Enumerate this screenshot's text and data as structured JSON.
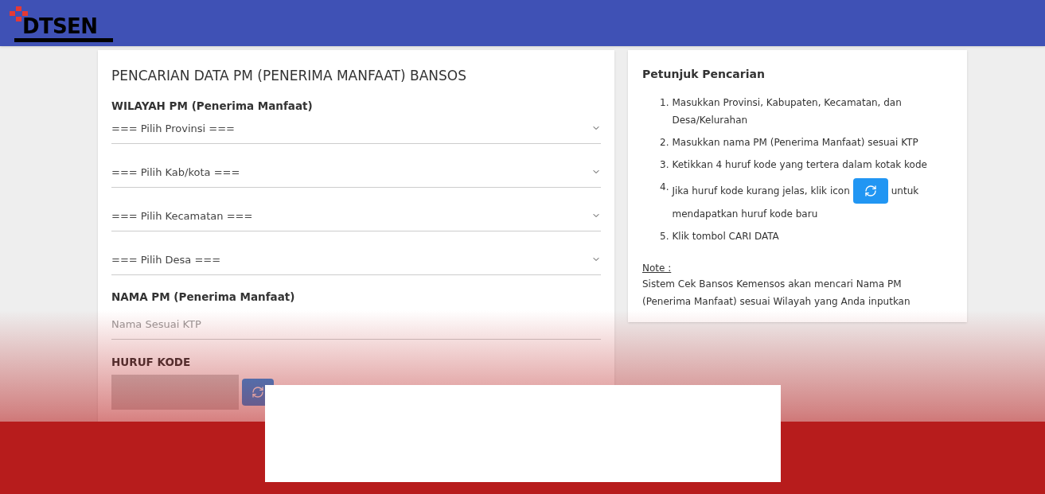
{
  "header": {
    "logo": "DTSEN"
  },
  "search_form": {
    "title": "PENCARIAN DATA PM (PENERIMA MANFAAT) BANSOS",
    "region_label": "WILAYAH PM (Penerima Manfaat)",
    "dropdowns": [
      {
        "placeholder": "=== Pilih Provinsi ==="
      },
      {
        "placeholder": "=== Pilih Kab/kota ==="
      },
      {
        "placeholder": "=== Pilih Kecamatan ==="
      },
      {
        "placeholder": "=== Pilih Desa ==="
      }
    ],
    "name_label": "NAMA PM (Penerima Manfaat)",
    "name_field": {
      "placeholder": "Nama Sesuai KTP"
    },
    "code_label": "HURUF KODE"
  },
  "guide": {
    "title": "Petunjuk Pencarian",
    "steps": [
      {
        "kind": "text",
        "number": "1.",
        "text": "Masukkan Provinsi, Kabupaten, Kecamatan, dan Desa/Kelurahan"
      },
      {
        "kind": "text",
        "number": "2.",
        "text": "Masukkan nama PM (Penerima Manfaat) sesuai KTP"
      },
      {
        "kind": "text",
        "number": "3.",
        "text": "Ketikkan 4 huruf kode yang tertera dalam kotak kode"
      },
      {
        "kind": "icon",
        "number": "4.",
        "before": "Jika huruf kode kurang jelas, klik icon",
        "after": "untuk",
        "continuation": "mendapatkan huruf kode baru"
      },
      {
        "kind": "text",
        "number": "5.",
        "text": "Klik tombol CARI DATA"
      }
    ],
    "note_label": "Note :",
    "note": "Sistem Cek Bansos Kemensos akan mencari Nama PM (Penerima Manfaat) sesuai Wilayah yang Anda inputkan"
  }
}
